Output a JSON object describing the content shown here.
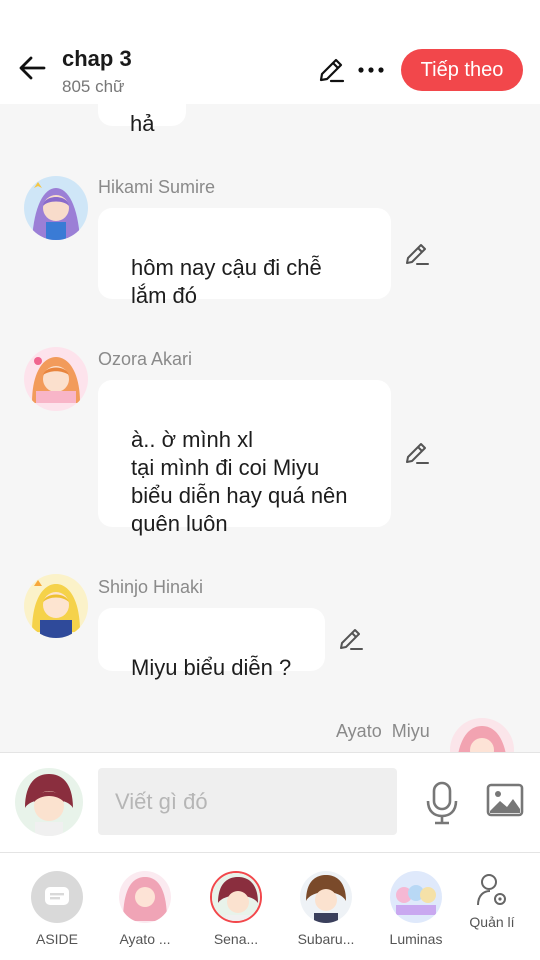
{
  "header": {
    "title": "chap 3",
    "subtitle": "805 chữ",
    "next_label": "Tiếp theo"
  },
  "messages": [
    {
      "sender": "",
      "text": "hả"
    },
    {
      "sender": "Hikami Sumire",
      "text": "hôm nay cậu đi chễ\nlắm đó"
    },
    {
      "sender": "Ozora Akari",
      "text": "à.. ờ mình xl\ntại mình đi coi Miyu\nbiểu diễn hay quá nên\nquên luôn"
    },
    {
      "sender": "Shinjo Hinaki",
      "text": "Miyu biểu diễn ?"
    },
    {
      "sender": "Ayato  Miyu",
      "text": ""
    }
  ],
  "composer": {
    "placeholder": "Viết gì đó"
  },
  "characters": [
    {
      "label": "ASIDE"
    },
    {
      "label": "Ayato ..."
    },
    {
      "label": "Sena..."
    },
    {
      "label": "Subaru..."
    },
    {
      "label": "Luminas"
    },
    {
      "label": "Quản lí"
    }
  ],
  "icons": {
    "back": "arrow-left-icon",
    "edit": "pencil-icon",
    "more": "more-dots-icon",
    "mic": "microphone-icon",
    "image": "image-icon",
    "manage": "user-gear-icon"
  },
  "colors": {
    "accent": "#f2474b",
    "background": "#f6f6f6",
    "bubble": "#ffffff"
  }
}
